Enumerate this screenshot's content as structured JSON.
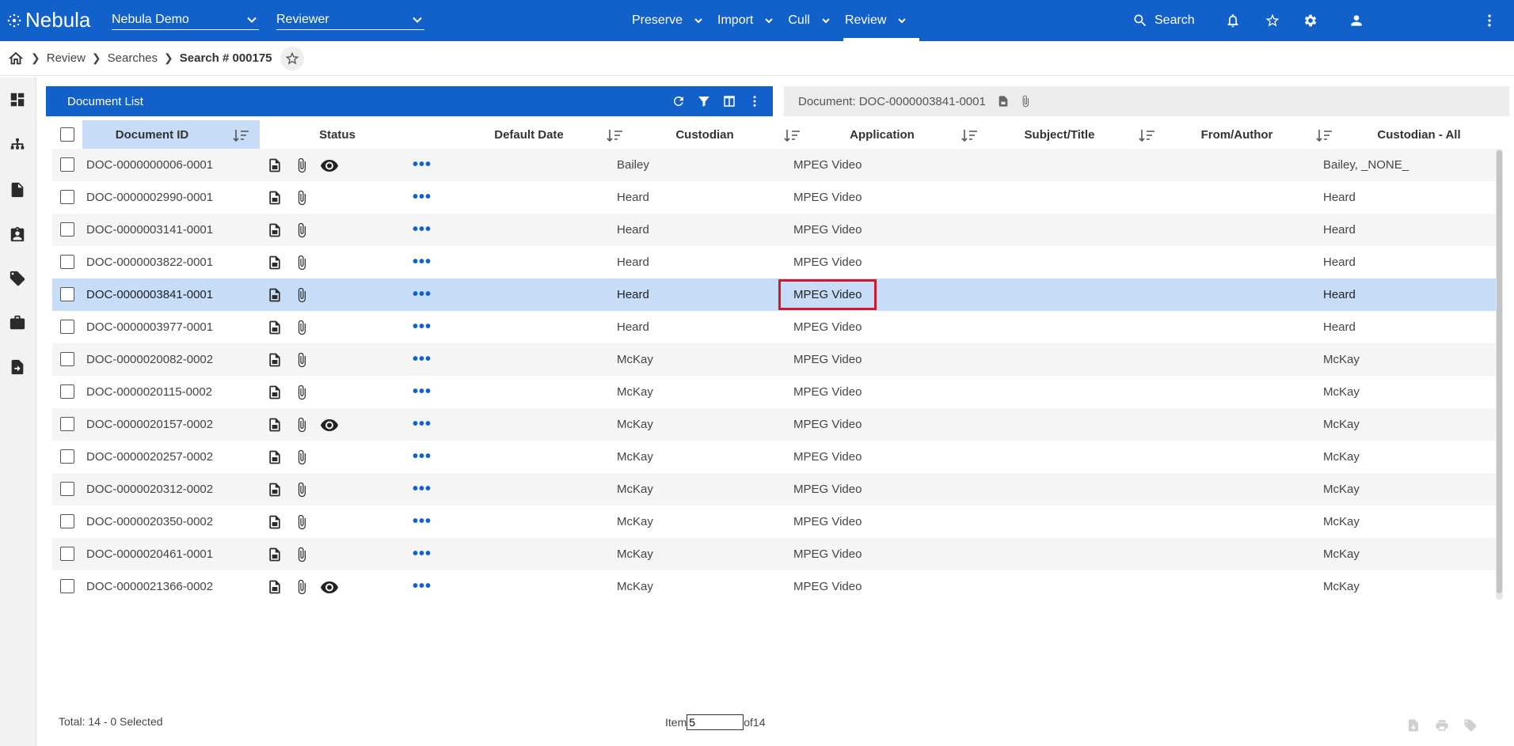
{
  "app": {
    "logo_text": "Nebula",
    "project_select": "Nebula Demo",
    "role_select": "Reviewer",
    "nav": [
      "Preserve",
      "Import",
      "Cull",
      "Review"
    ],
    "active_nav": "Review",
    "search_label": "Search"
  },
  "breadcrumb": {
    "items": [
      "Review",
      "Searches"
    ],
    "current": "Search # 000175"
  },
  "panel": {
    "title": "Document List",
    "document_tab": "Document: DOC-0000003841-0001"
  },
  "columns": {
    "doc_id": "Document ID",
    "status": "Status",
    "default_date": "Default Date",
    "custodian": "Custodian",
    "application": "Application",
    "subject": "Subject/Title",
    "from": "From/Author",
    "custodian_all": "Custodian - All"
  },
  "rows": [
    {
      "doc_id": "DOC-0000000006-0001",
      "viewed": true,
      "custodian": "Bailey",
      "application": "MPEG Video",
      "custodian_all": "Bailey, _NONE_"
    },
    {
      "doc_id": "DOC-0000002990-0001",
      "viewed": false,
      "custodian": "Heard",
      "application": "MPEG Video",
      "custodian_all": "Heard"
    },
    {
      "doc_id": "DOC-0000003141-0001",
      "viewed": false,
      "custodian": "Heard",
      "application": "MPEG Video",
      "custodian_all": "Heard"
    },
    {
      "doc_id": "DOC-0000003822-0001",
      "viewed": false,
      "custodian": "Heard",
      "application": "MPEG Video",
      "custodian_all": "Heard"
    },
    {
      "doc_id": "DOC-0000003841-0001",
      "viewed": false,
      "custodian": "Heard",
      "application": "MPEG Video",
      "custodian_all": "Heard"
    },
    {
      "doc_id": "DOC-0000003977-0001",
      "viewed": false,
      "custodian": "Heard",
      "application": "MPEG Video",
      "custodian_all": "Heard"
    },
    {
      "doc_id": "DOC-0000020082-0002",
      "viewed": false,
      "custodian": "McKay",
      "application": "MPEG Video",
      "custodian_all": "McKay"
    },
    {
      "doc_id": "DOC-0000020115-0002",
      "viewed": false,
      "custodian": "McKay",
      "application": "MPEG Video",
      "custodian_all": "McKay"
    },
    {
      "doc_id": "DOC-0000020157-0002",
      "viewed": true,
      "custodian": "McKay",
      "application": "MPEG Video",
      "custodian_all": "McKay"
    },
    {
      "doc_id": "DOC-0000020257-0002",
      "viewed": false,
      "custodian": "McKay",
      "application": "MPEG Video",
      "custodian_all": "McKay"
    },
    {
      "doc_id": "DOC-0000020312-0002",
      "viewed": false,
      "custodian": "McKay",
      "application": "MPEG Video",
      "custodian_all": "McKay"
    },
    {
      "doc_id": "DOC-0000020350-0002",
      "viewed": false,
      "custodian": "McKay",
      "application": "MPEG Video",
      "custodian_all": "McKay"
    },
    {
      "doc_id": "DOC-0000020461-0001",
      "viewed": false,
      "custodian": "McKay",
      "application": "MPEG Video",
      "custodian_all": "McKay"
    },
    {
      "doc_id": "DOC-0000021366-0002",
      "viewed": true,
      "custodian": "McKay",
      "application": "MPEG Video",
      "custodian_all": "McKay"
    }
  ],
  "selected_row_index": 4,
  "highlighted_cell": "MPEG Video",
  "footer": {
    "total": "Total: 14 - 0 Selected",
    "item_label": "Item",
    "item_value": "5",
    "of_label": "of14"
  },
  "colors": {
    "brand_blue": "#1260c9",
    "selected_row": "#c7dcf7",
    "highlight": "#d0192a"
  }
}
